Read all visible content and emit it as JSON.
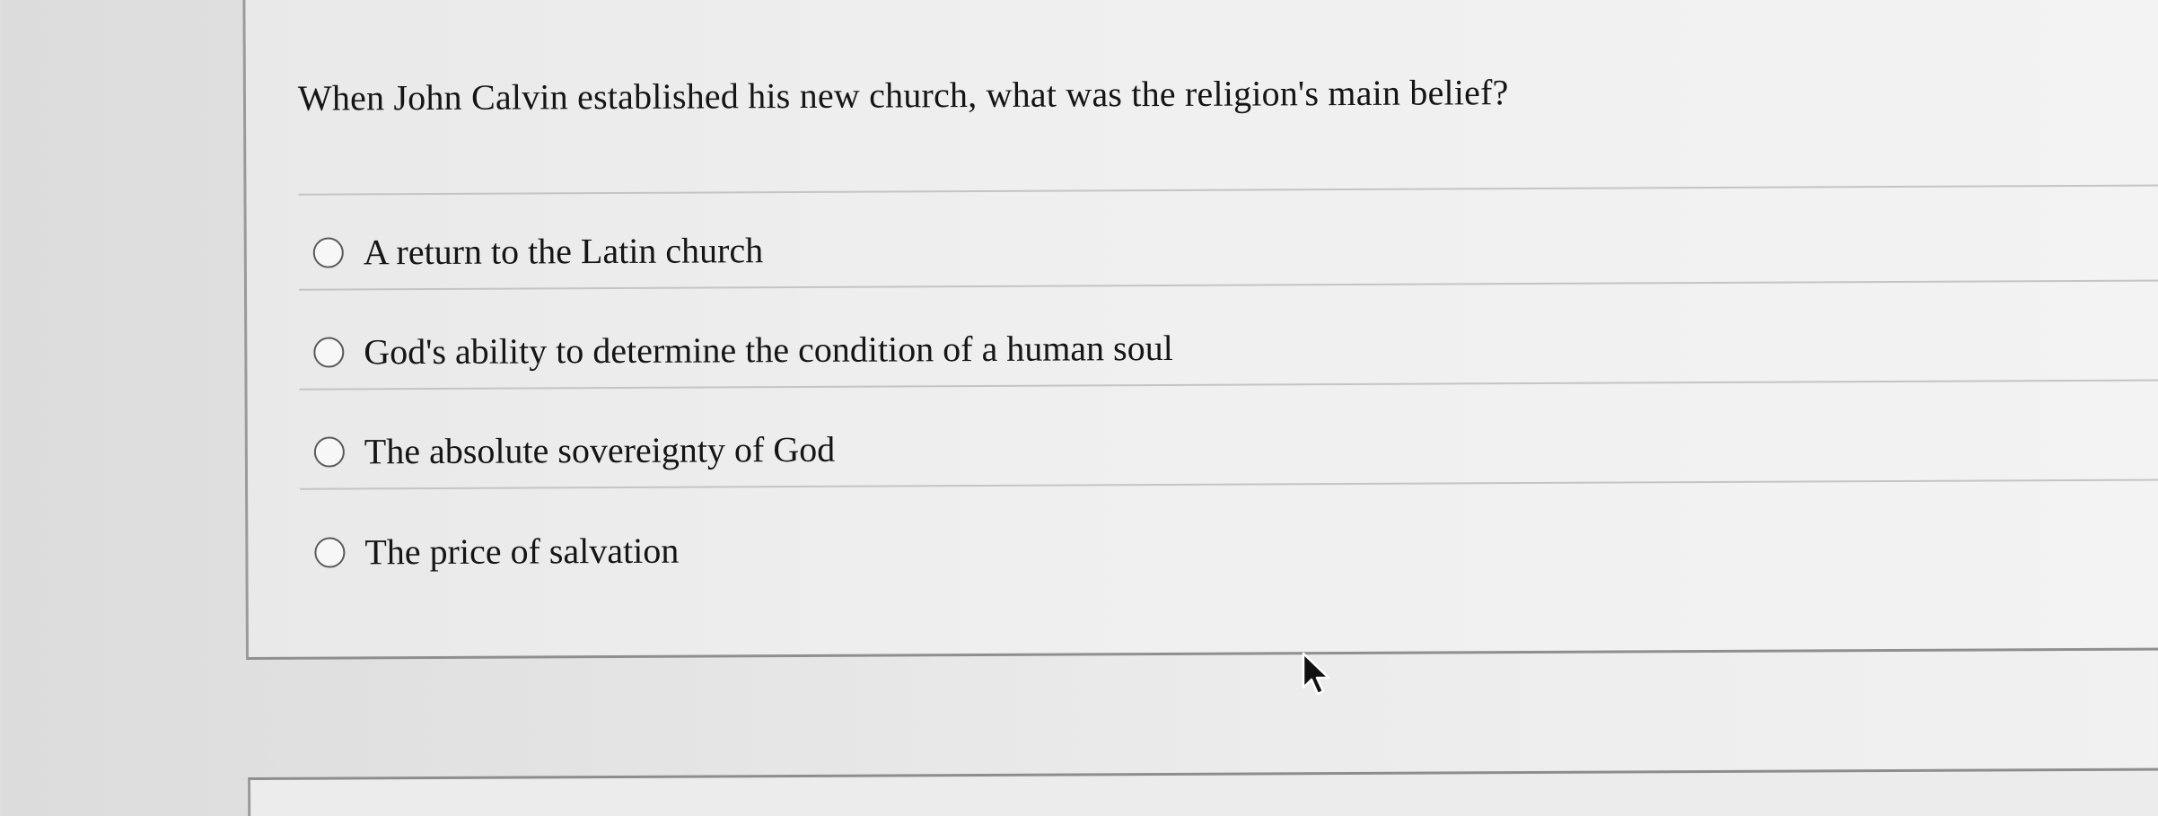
{
  "question": {
    "text": "When John Calvin established his new church, what was the religion's main belief?",
    "options": [
      {
        "label": "A return to the Latin church",
        "selected": false
      },
      {
        "label": "God's ability to determine the condition of a human soul",
        "selected": false
      },
      {
        "label": "The absolute sovereignty of God",
        "selected": false
      },
      {
        "label": "The price of salvation",
        "selected": false
      }
    ]
  },
  "colors": {
    "page_background": "#e4e4e4",
    "card_border": "#9a9a9a",
    "divider": "#c4c4c4",
    "radio_border": "#5a5a5a",
    "text": "#151515"
  },
  "icons": {
    "cursor": "mouse-pointer-icon",
    "radio": "radio-button-icon"
  }
}
